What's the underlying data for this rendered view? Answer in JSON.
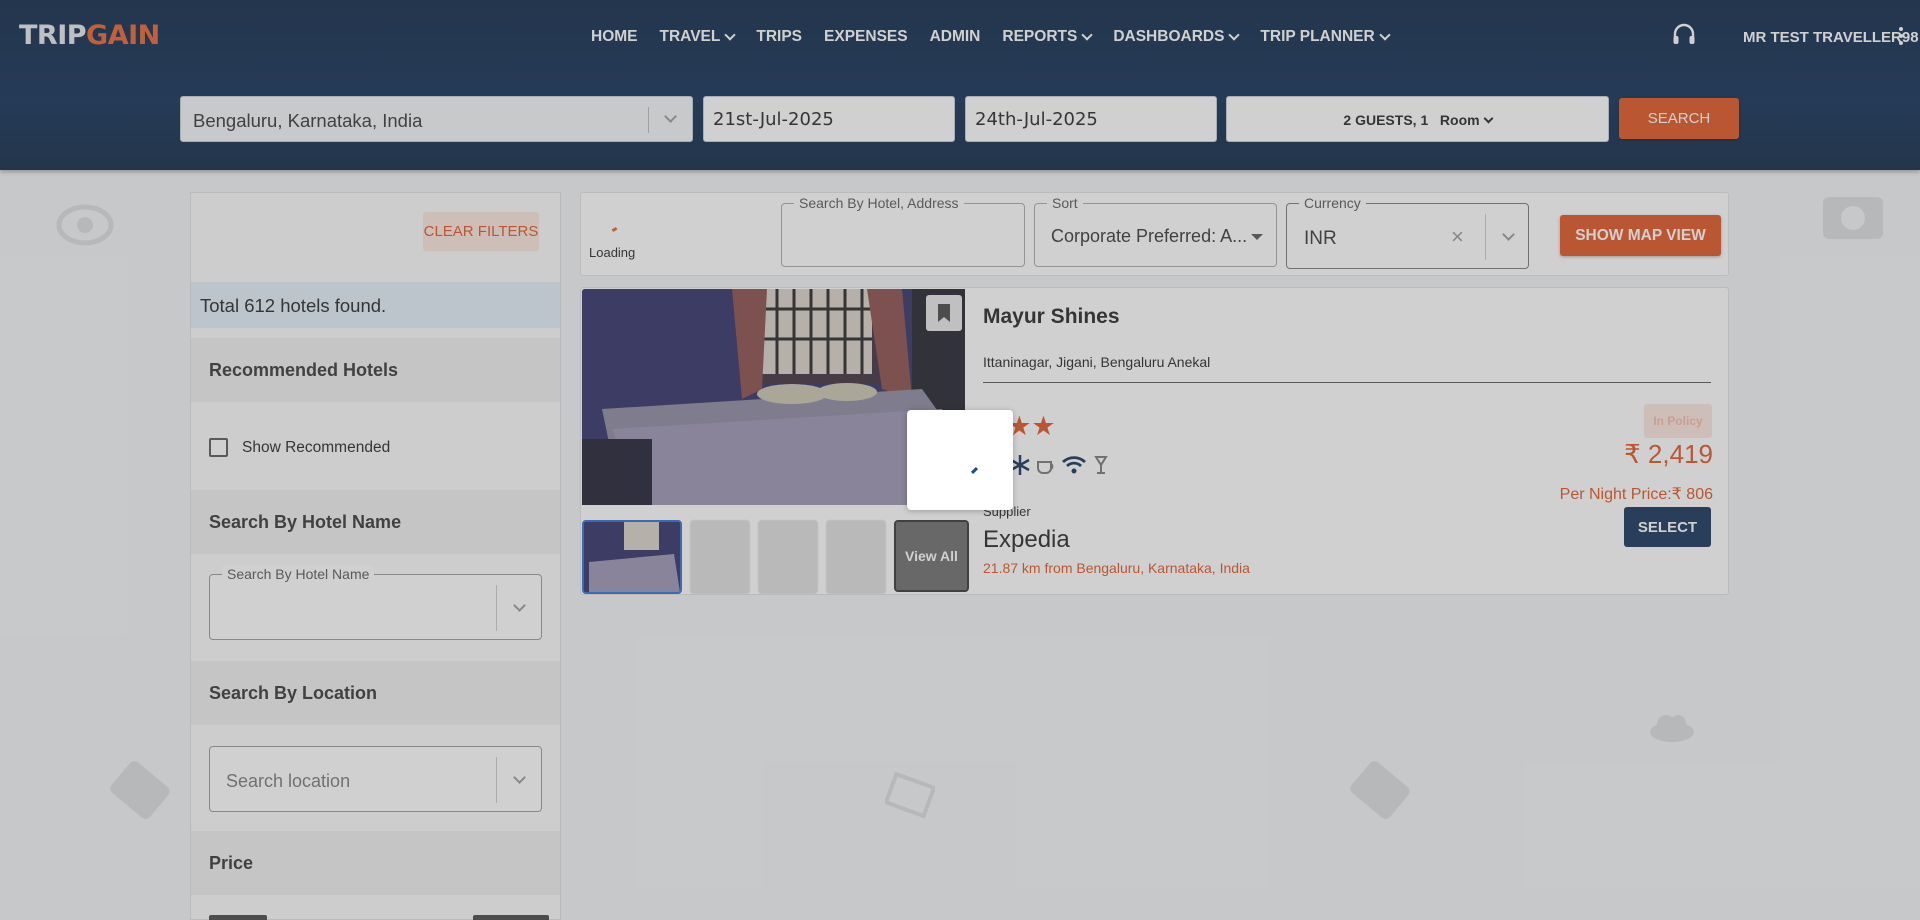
{
  "brand": {
    "logo_prefix": "TRIP",
    "logo_suffix": "GAIN"
  },
  "nav": [
    {
      "label": "HOME",
      "dropdown": false
    },
    {
      "label": "TRAVEL",
      "dropdown": true
    },
    {
      "label": "TRIPS",
      "dropdown": false
    },
    {
      "label": "EXPENSES",
      "dropdown": false
    },
    {
      "label": "ADMIN",
      "dropdown": false
    },
    {
      "label": "REPORTS",
      "dropdown": true
    },
    {
      "label": "DASHBOARDS",
      "dropdown": true
    },
    {
      "label": "TRIP PLANNER",
      "dropdown": true
    }
  ],
  "user": {
    "name": "MR TEST TRAVELLER98"
  },
  "search": {
    "city": "Bengaluru, Karnataka, India",
    "check_in": "21st-Jul-2025",
    "check_out": "24th-Jul-2025",
    "guests": "2 GUESTS, 1",
    "rooms_label": "Room",
    "search_label": "SEARCH"
  },
  "filters": {
    "clear_label": "CLEAR FILTERS",
    "total": "Total 612 hotels found.",
    "recommended_head": "Recommended Hotels",
    "show_recommended": "Show Recommended",
    "hotel_name_head": "Search By Hotel Name",
    "hotel_name_label": "Search By Hotel Name",
    "location_head": "Search By Location",
    "location_placeholder": "Search location",
    "price_head": "Price"
  },
  "toolbar": {
    "loading": "Loading",
    "hotel_address_label": "Search By Hotel, Address",
    "sort_label": "Sort",
    "sort_value": "Corporate Preferred: A...",
    "currency_label": "Currency",
    "currency_value": "INR",
    "map_label": "SHOW MAP VIEW"
  },
  "hotel": {
    "name": "Mayur Shines",
    "address": "Ittaninagar, Jigani, Bengaluru Anekal",
    "stars": "★★★",
    "badge": "In Policy",
    "price": "₹ 2,419",
    "per_night": "Per Night Price:₹ 806",
    "supplier_label": "Supplier",
    "supplier": "Expedia",
    "distance": "21.87 km from Bengaluru, Karnataka, India",
    "select_label": "SELECT",
    "view_all": "View All",
    "amenities": [
      "tv-icon",
      "ac-icon",
      "coffee-icon",
      "wifi-icon",
      "bar-icon"
    ]
  },
  "colors": {
    "brand_orange": "#e0521e",
    "navy": "#0b2a52",
    "select_navy": "#0f2f57"
  }
}
